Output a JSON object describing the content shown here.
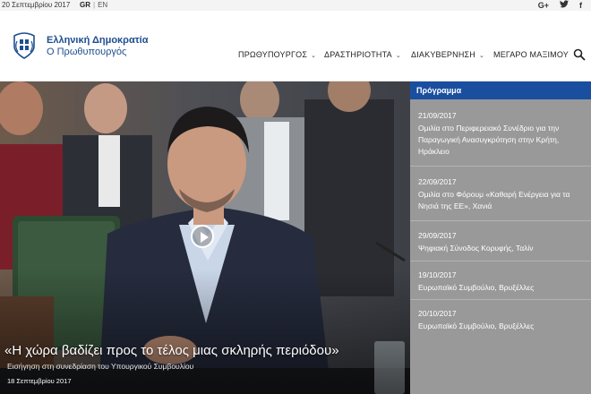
{
  "topbar": {
    "date": "20 Σεπτεμβρίου 2017",
    "lang_gr": "GR",
    "lang_sep": "|",
    "lang_en": "EN",
    "social": [
      {
        "icon": "google-plus-icon",
        "glyph": "G+"
      },
      {
        "icon": "twitter-icon",
        "glyph": "🐦"
      },
      {
        "icon": "facebook-icon",
        "glyph": "f"
      }
    ]
  },
  "brand": {
    "line1": "Ελληνική Δημοκρατία",
    "line2": "Ο Πρωθυπουργός",
    "color": "#1d4e8f"
  },
  "nav": {
    "items": [
      {
        "label": "ΠΡΩΘΥΠΟΥΡΓΟΣ",
        "chev": "⌄"
      },
      {
        "label": "ΔΡΑΣΤΗΡΙΟΤΗΤΑ",
        "chev": "⌄"
      },
      {
        "label": "ΔΙΑΚΥΒΕΡΝΗΣΗ",
        "chev": "⌄"
      },
      {
        "label": "ΜΕΓΑΡΟ ΜΑΞΙΜΟΥ",
        "chev": ""
      }
    ]
  },
  "hero": {
    "title": "«Η χώρα βαδίζει προς το τέλος μιας σκληρής περιόδου»",
    "subtitle": "Εισήγηση στη συνεδρίαση του Υπουργικού Συμβουλίου",
    "date": "18 Σεπτεμβρίου 2017"
  },
  "schedule": {
    "heading": "Πρόγραμμα",
    "accent": "#1a4fa0",
    "events": [
      {
        "date": "21/09/2017",
        "title": "Ομιλία στο Περιφερειακό Συνέδριο για την Παραγωγική Ανασυγκρότηση στην Κρήτη, Ηράκλειο"
      },
      {
        "date": "22/09/2017",
        "title": "Ομιλία στο Φόρουμ «Καθαρή Ενέργεια για τα Νησιά της ΕΕ», Χανιά"
      },
      {
        "date": "29/09/2017",
        "title": "Ψηφιακή Σύνοδος Κορυφής, Ταλίν"
      },
      {
        "date": "19/10/2017",
        "title": "Ευρωπαϊκό Συμβούλιο, Βρυξέλλες"
      },
      {
        "date": "20/10/2017",
        "title": "Ευρωπαϊκό Συμβούλιο, Βρυξέλλες"
      }
    ]
  }
}
